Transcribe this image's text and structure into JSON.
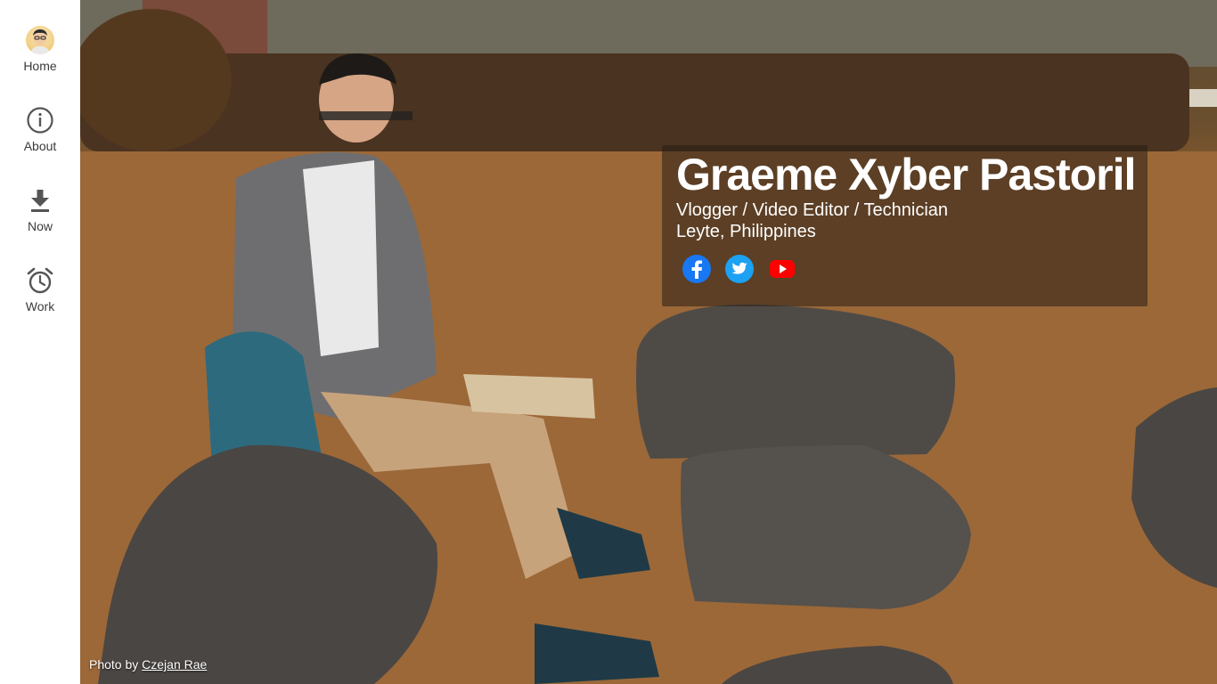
{
  "sidebar": {
    "items": [
      {
        "label": "Home",
        "icon": "avatar"
      },
      {
        "label": "About",
        "icon": "info-icon"
      },
      {
        "label": "Now",
        "icon": "download-icon"
      },
      {
        "label": "Work",
        "icon": "alarm-clock-icon"
      }
    ]
  },
  "profile": {
    "name": "Graeme Xyber Pastoril",
    "roles": "Vlogger / Video Editor / Technician",
    "location": "Leyte, Philippines",
    "social": [
      {
        "icon": "facebook-icon",
        "color": "#1877f2"
      },
      {
        "icon": "twitter-icon",
        "color": "#1da1f2"
      },
      {
        "icon": "youtube-icon",
        "color": "#ff0000"
      }
    ]
  },
  "credit": {
    "prefix": "Photo by ",
    "author": "Czejan Rae"
  }
}
